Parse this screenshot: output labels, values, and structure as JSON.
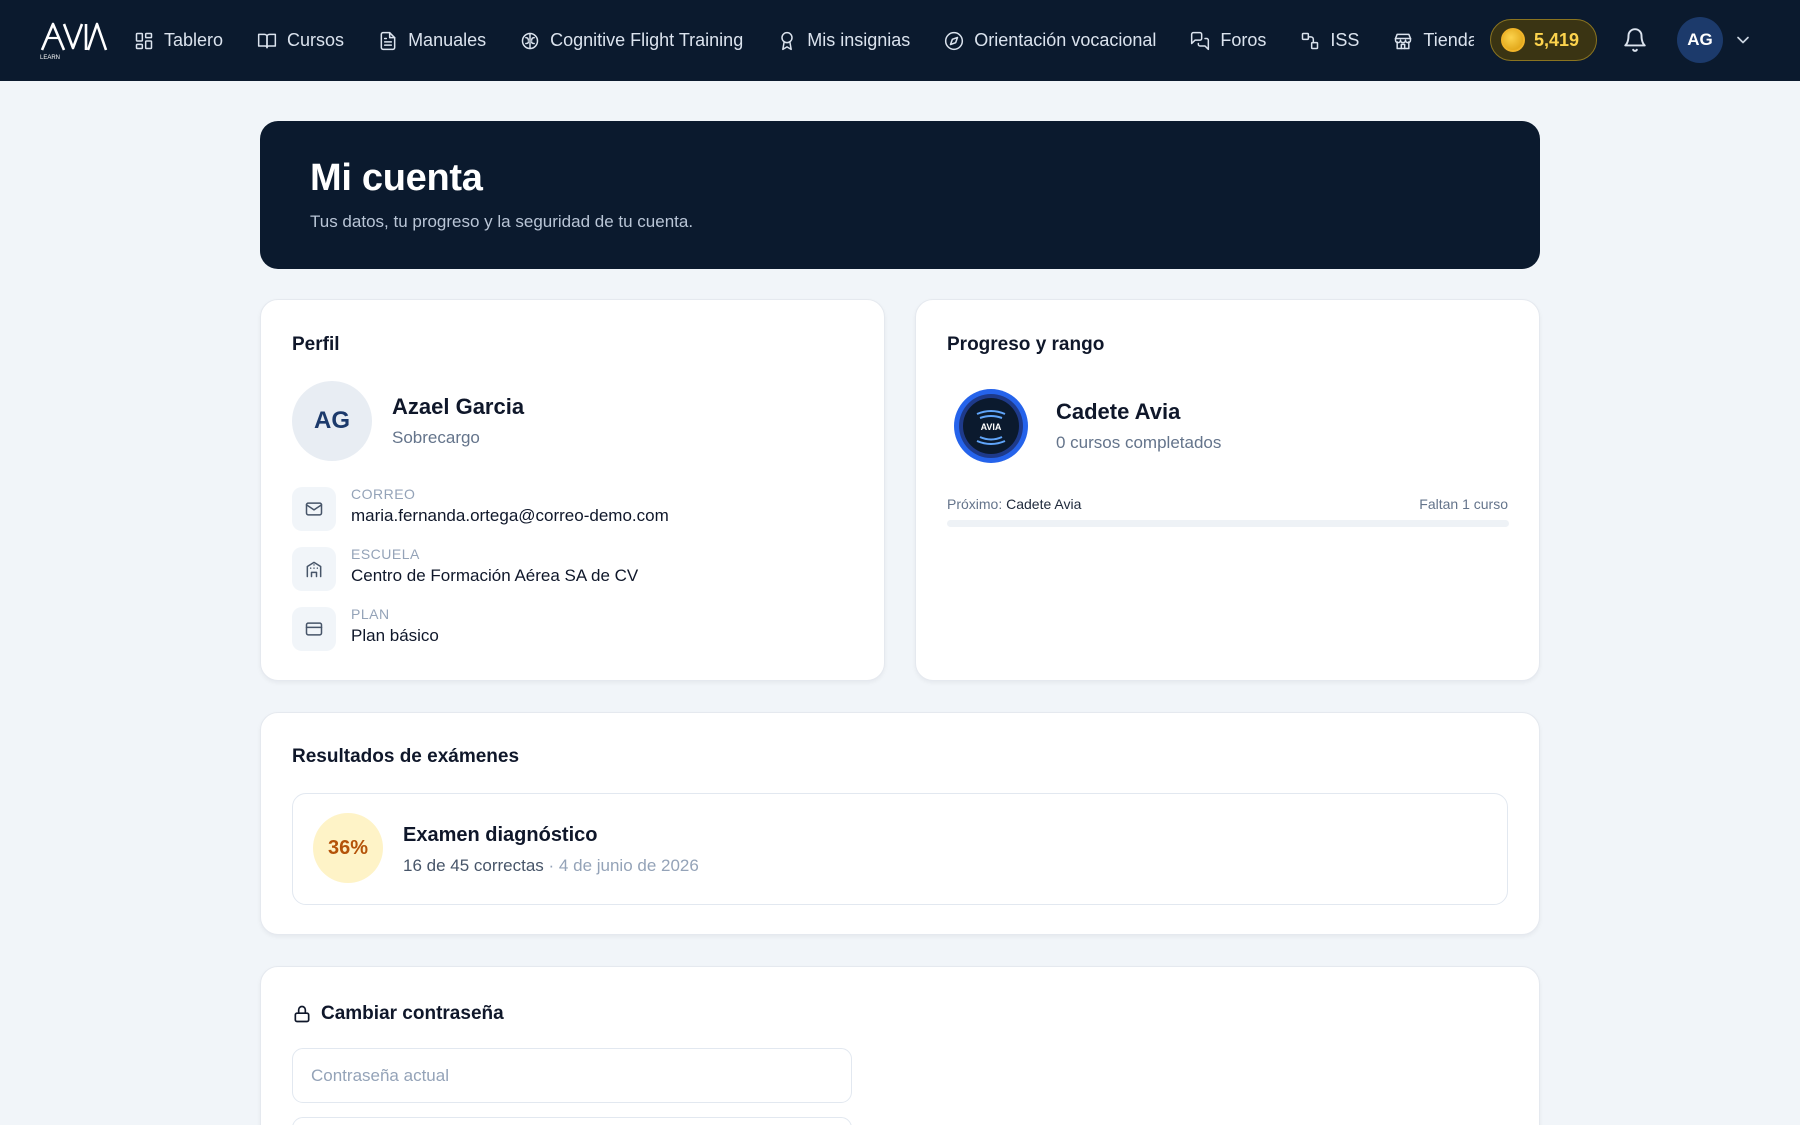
{
  "nav": {
    "items": [
      {
        "label": "Tablero",
        "icon": "grid-icon"
      },
      {
        "label": "Cursos",
        "icon": "book-open-icon"
      },
      {
        "label": "Manuales",
        "icon": "file-text-icon"
      },
      {
        "label": "Cognitive Flight Training",
        "icon": "brain-icon"
      },
      {
        "label": "Mis insignias",
        "icon": "award-icon"
      },
      {
        "label": "Orientación vocacional",
        "icon": "compass-icon"
      },
      {
        "label": "Foros",
        "icon": "messages-icon"
      },
      {
        "label": "ISS",
        "icon": "satellite-icon"
      },
      {
        "label": "Tienda",
        "icon": "store-icon"
      }
    ],
    "coins": "5,419",
    "user_initials": "AG"
  },
  "hero": {
    "title": "Mi cuenta",
    "subtitle": "Tus datos, tu progreso y la seguridad de tu cuenta."
  },
  "profile": {
    "title": "Perfil",
    "initials": "AG",
    "name": "Azael Garcia",
    "role": "Sobrecargo",
    "fields": [
      {
        "label": "CORREO",
        "value": "maria.fernanda.ortega@correo-demo.com",
        "icon": "mail-icon"
      },
      {
        "label": "ESCUELA",
        "value": "Centro de Formación Aérea SA de CV",
        "icon": "building-icon"
      },
      {
        "label": "PLAN",
        "value": "Plan básico",
        "icon": "credit-card-icon"
      }
    ]
  },
  "progress": {
    "title": "Progreso y rango",
    "badge_text": "AVIA",
    "rank": "Cadete Avia",
    "completed": "0 cursos completados",
    "next_label": "Próximo:",
    "next_rank": "Cadete Avia",
    "remaining": "Faltan 1 curso",
    "progress_fraction": 0
  },
  "exams": {
    "title": "Resultados de exámenes",
    "items": [
      {
        "score": "36%",
        "name": "Examen diagnóstico",
        "detail": "16 de 45 correctas",
        "date": "· 4 de junio de 2026"
      }
    ]
  },
  "password": {
    "title": "Cambiar contraseña",
    "current_placeholder": "Contraseña actual",
    "new_placeholder": ""
  },
  "colors": {
    "navy": "#0b1a2e",
    "accent": "#2563eb",
    "coin": "#fcd34d",
    "score_bg": "#fef3c7",
    "score_text": "#b45309"
  }
}
